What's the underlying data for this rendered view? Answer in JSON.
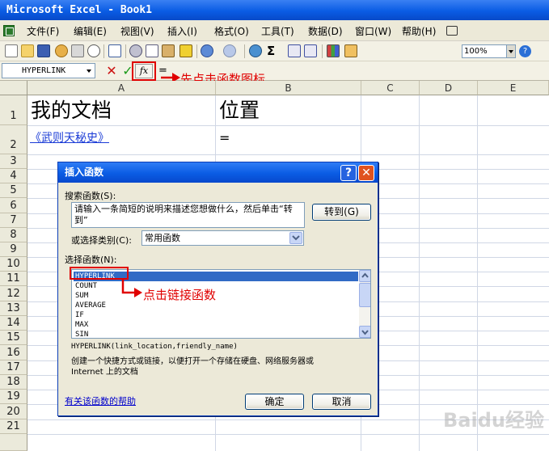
{
  "window": {
    "title": "Microsoft Excel - Book1"
  },
  "menu": [
    "文件(F)",
    "编辑(E)",
    "视图(V)",
    "插入(I)",
    "格式(O)",
    "工具(T)",
    "数据(D)",
    "窗口(W)",
    "帮助(H)"
  ],
  "toolbar": {
    "zoom": "100%",
    "icons": [
      "new-icon",
      "open-icon",
      "save-icon",
      "permission-icon",
      "print-icon",
      "print-preview-icon",
      "spelling-icon",
      "cut-icon",
      "copy-icon",
      "paste-icon",
      "format-painter-icon",
      "undo-icon",
      "redo-icon",
      "hyperlink-icon",
      "autosum-icon",
      "sort-asc-icon",
      "sort-desc-icon",
      "chart-wizard-icon",
      "drawing-icon"
    ]
  },
  "formula_bar": {
    "name_box": "HYPERLINK",
    "cancel_symbol": "✕",
    "enter_symbol": "✓",
    "fx_symbol": "fx",
    "content": "="
  },
  "grid": {
    "columns": [
      "A",
      "B",
      "C",
      "D",
      "E"
    ],
    "rows": [
      "1",
      "2",
      "3",
      "4",
      "5",
      "6",
      "7",
      "8",
      "9",
      "10",
      "11",
      "12",
      "13",
      "14",
      "15",
      "16",
      "17",
      "18",
      "19",
      "20",
      "21"
    ],
    "cells": {
      "A1": "我的文档",
      "B1": "位置",
      "A2": "《武则天秘史》",
      "B2": "="
    }
  },
  "dialog": {
    "title": "插入函数",
    "help_btn": "?",
    "close_btn": "✕",
    "search_label": "搜索函数(S):",
    "search_text": "请输入一条简短的说明来描述您想做什么，然后单击“转到”",
    "go_button": "转到(G)",
    "category_label": "或选择类别(C):",
    "category_value": "常用函数",
    "select_label": "选择函数(N):",
    "functions": [
      "HYPERLINK",
      "COUNT",
      "SUM",
      "AVERAGE",
      "IF",
      "MAX",
      "SIN"
    ],
    "selected_index": 0,
    "syntax": "HYPERLINK(link_location,friendly_name)",
    "description_line1": "创建一个快捷方式或链接，以便打开一个存储在硬盘、网络服务器或",
    "description_line2": "Internet 上的文档",
    "help_link": "有关该函数的帮助",
    "ok_button": "确定",
    "cancel_button": "取消"
  },
  "annotations": {
    "fx_hint": "先点击函数图标",
    "list_hint": "点击链接函数"
  },
  "watermark": "Baidu经验",
  "colors": {
    "title_blue": "#0a5ce4",
    "annotation_red": "#e00000",
    "selection_blue": "#316ac5",
    "link_blue": "#1a3bd6"
  }
}
